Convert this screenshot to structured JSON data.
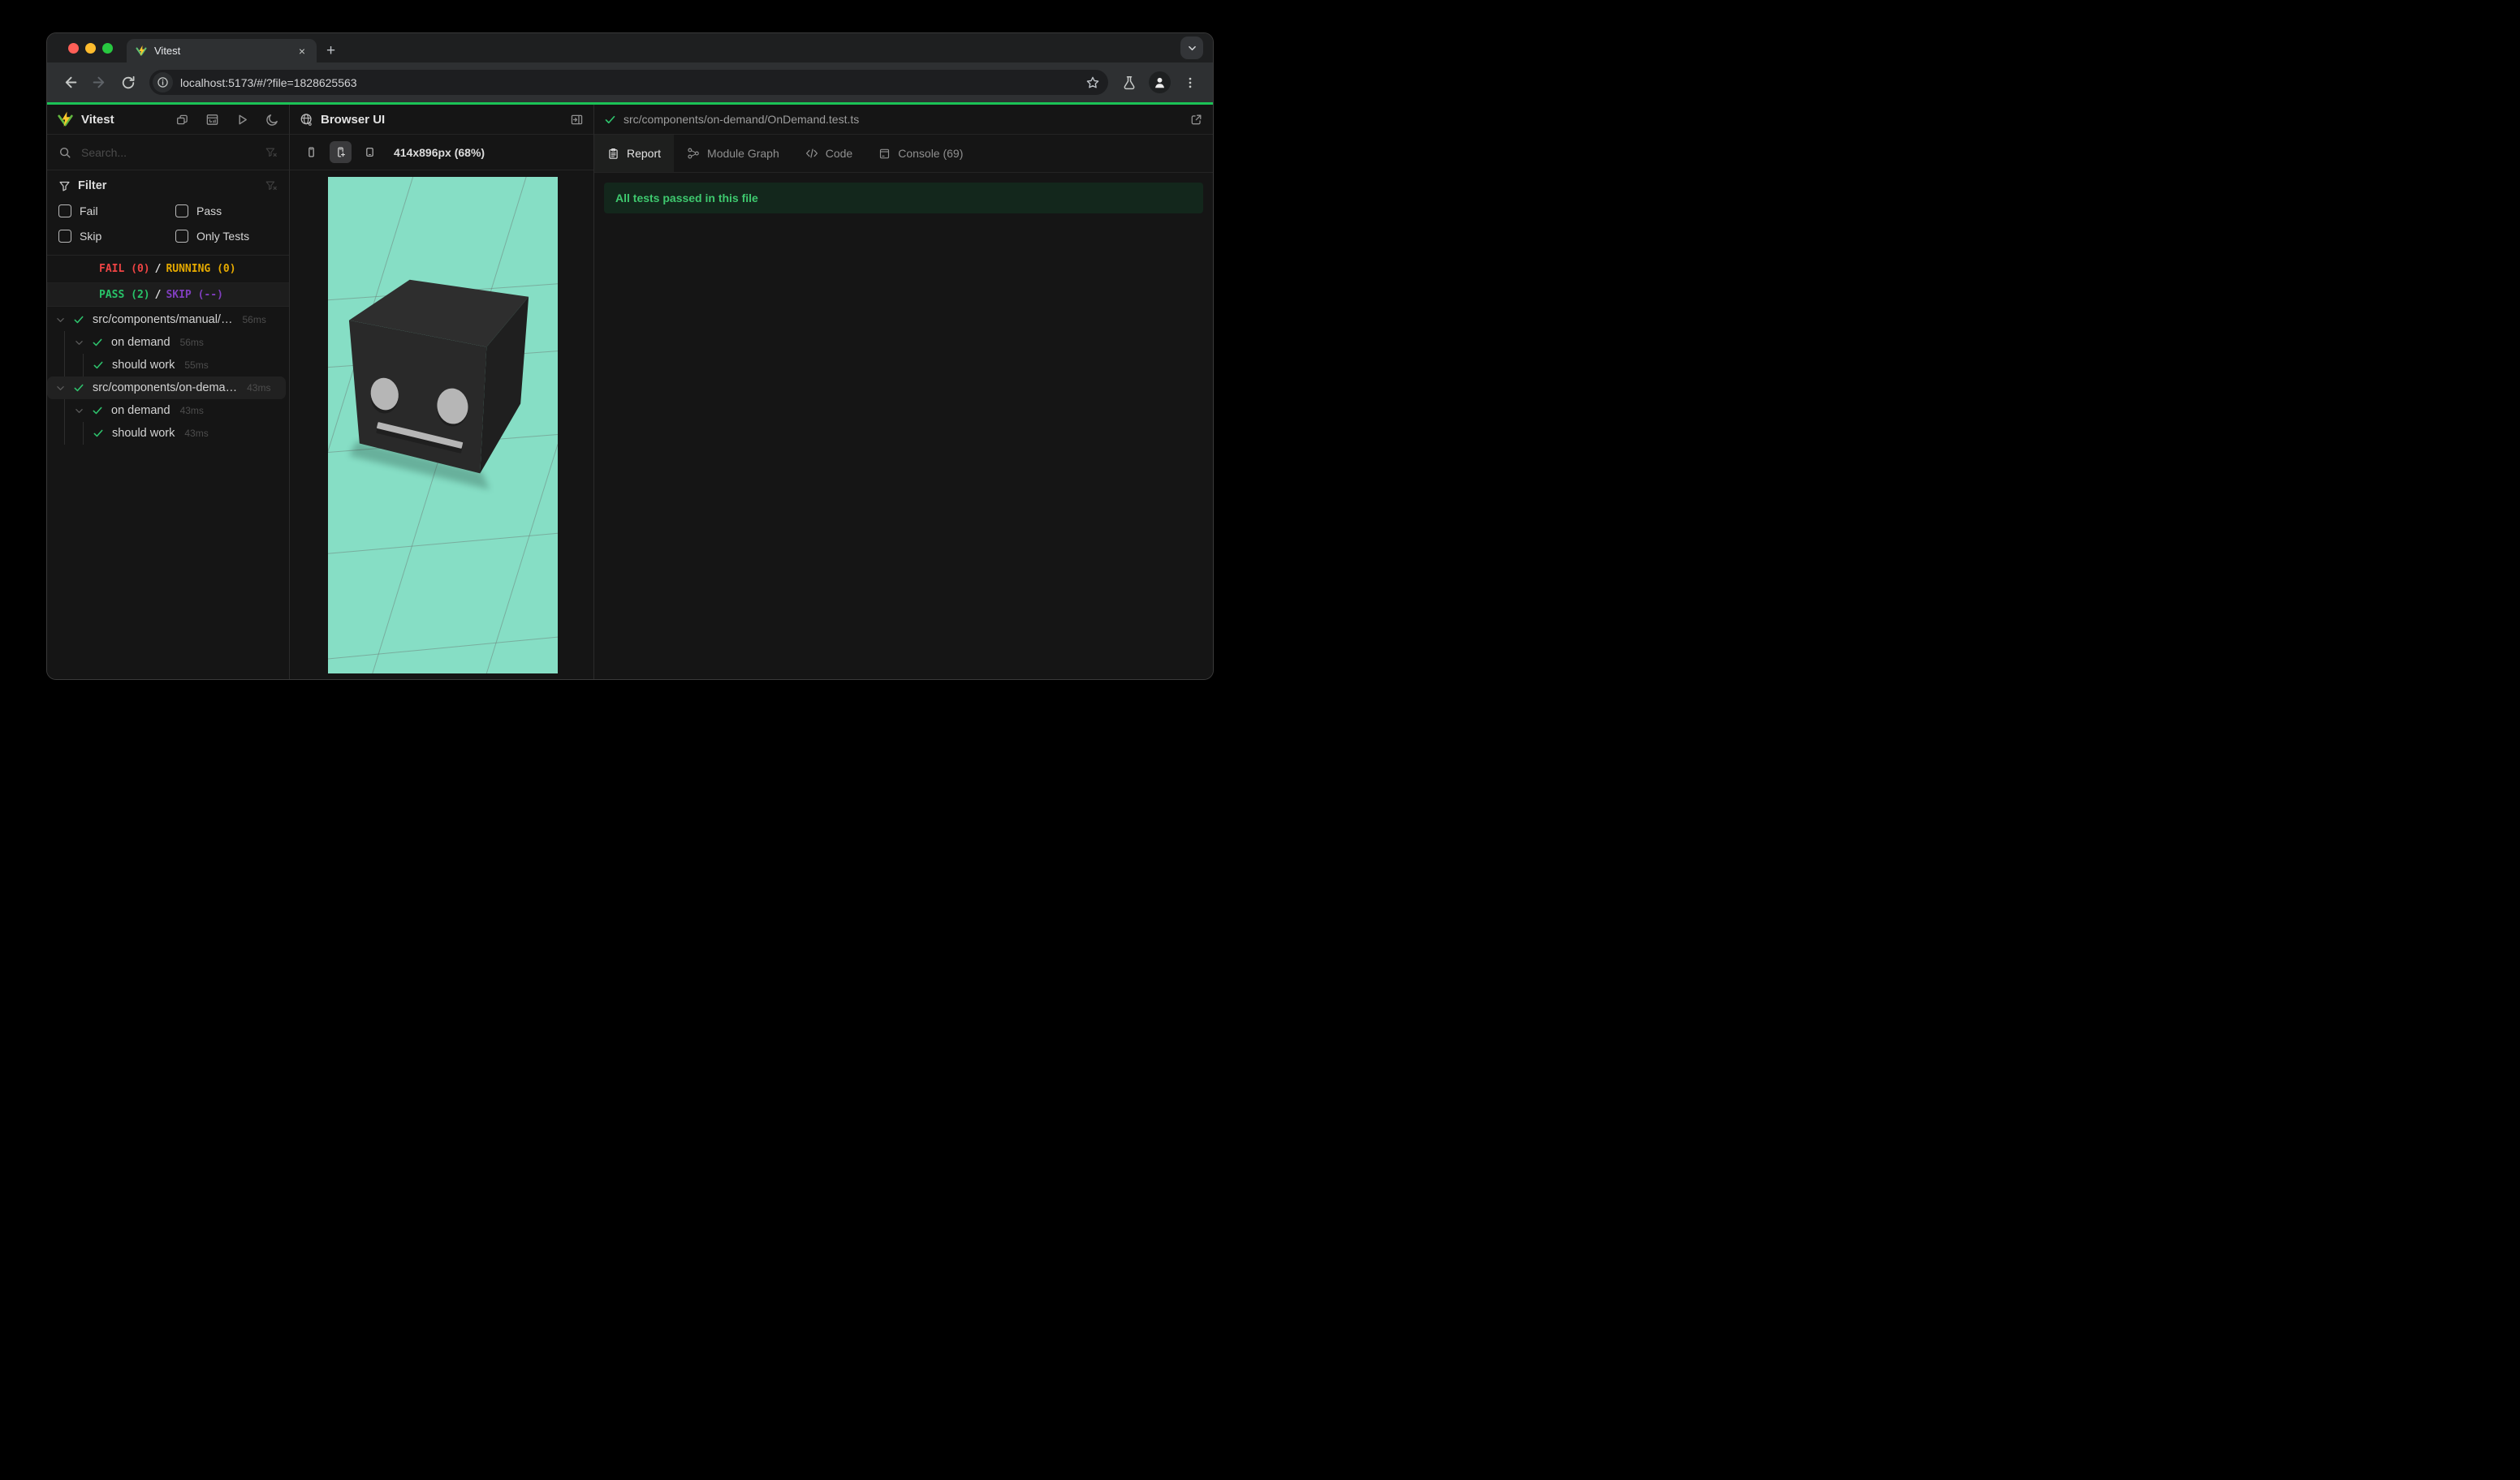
{
  "browser": {
    "tab_title": "Vitest",
    "close_label": "×",
    "new_tab_label": "+",
    "url": "localhost:5173/#/?file=1828625563"
  },
  "sidebar": {
    "title": "Vitest",
    "search_placeholder": "Search...",
    "filter": {
      "title": "Filter",
      "options": [
        "Fail",
        "Pass",
        "Skip",
        "Only Tests"
      ],
      "checked": [
        false,
        false,
        false,
        false
      ]
    },
    "summary": {
      "fail": "FAIL (0)",
      "running": "RUNNING (0)",
      "pass": "PASS (2)",
      "skip": "SKIP (--)",
      "separator": "/"
    },
    "tree": [
      {
        "kind": "file",
        "label": "src/components/manual/…",
        "duration": "56ms",
        "status": "pass",
        "expanded": true,
        "selected": false
      },
      {
        "kind": "suite",
        "label": "on demand",
        "duration": "56ms",
        "status": "pass",
        "expanded": true,
        "selected": false
      },
      {
        "kind": "test",
        "label": "should work",
        "duration": "55ms",
        "status": "pass",
        "selected": false
      },
      {
        "kind": "file",
        "label": "src/components/on-dema…",
        "duration": "43ms",
        "status": "pass",
        "expanded": true,
        "selected": true
      },
      {
        "kind": "suite",
        "label": "on demand",
        "duration": "43ms",
        "status": "pass",
        "expanded": true,
        "selected": false
      },
      {
        "kind": "test",
        "label": "should work",
        "duration": "43ms",
        "status": "pass",
        "selected": false
      }
    ]
  },
  "preview": {
    "title": "Browser UI",
    "size_label": "414x896px (68%)",
    "viewport_background": "#86dec5"
  },
  "results": {
    "file_path": "src/components/on-demand/OnDemand.test.ts",
    "tabs": [
      {
        "label": "Report",
        "active": true
      },
      {
        "label": "Module Graph",
        "active": false
      },
      {
        "label": "Code",
        "active": false
      },
      {
        "label": "Console (69)",
        "active": false
      }
    ],
    "banner": "All tests passed in this file"
  },
  "colors": {
    "fail": "#ef4444",
    "running": "#e6aa00",
    "pass": "#28c369",
    "skip": "#803ebe",
    "progress_bar": "#1bc256",
    "banner_bg": "#13271c",
    "banner_text": "#3ec86e",
    "mint_viewport": "#86dec5",
    "traffic_red": "#ff5f57",
    "traffic_yellow": "#febc2e",
    "traffic_green": "#28c840"
  }
}
